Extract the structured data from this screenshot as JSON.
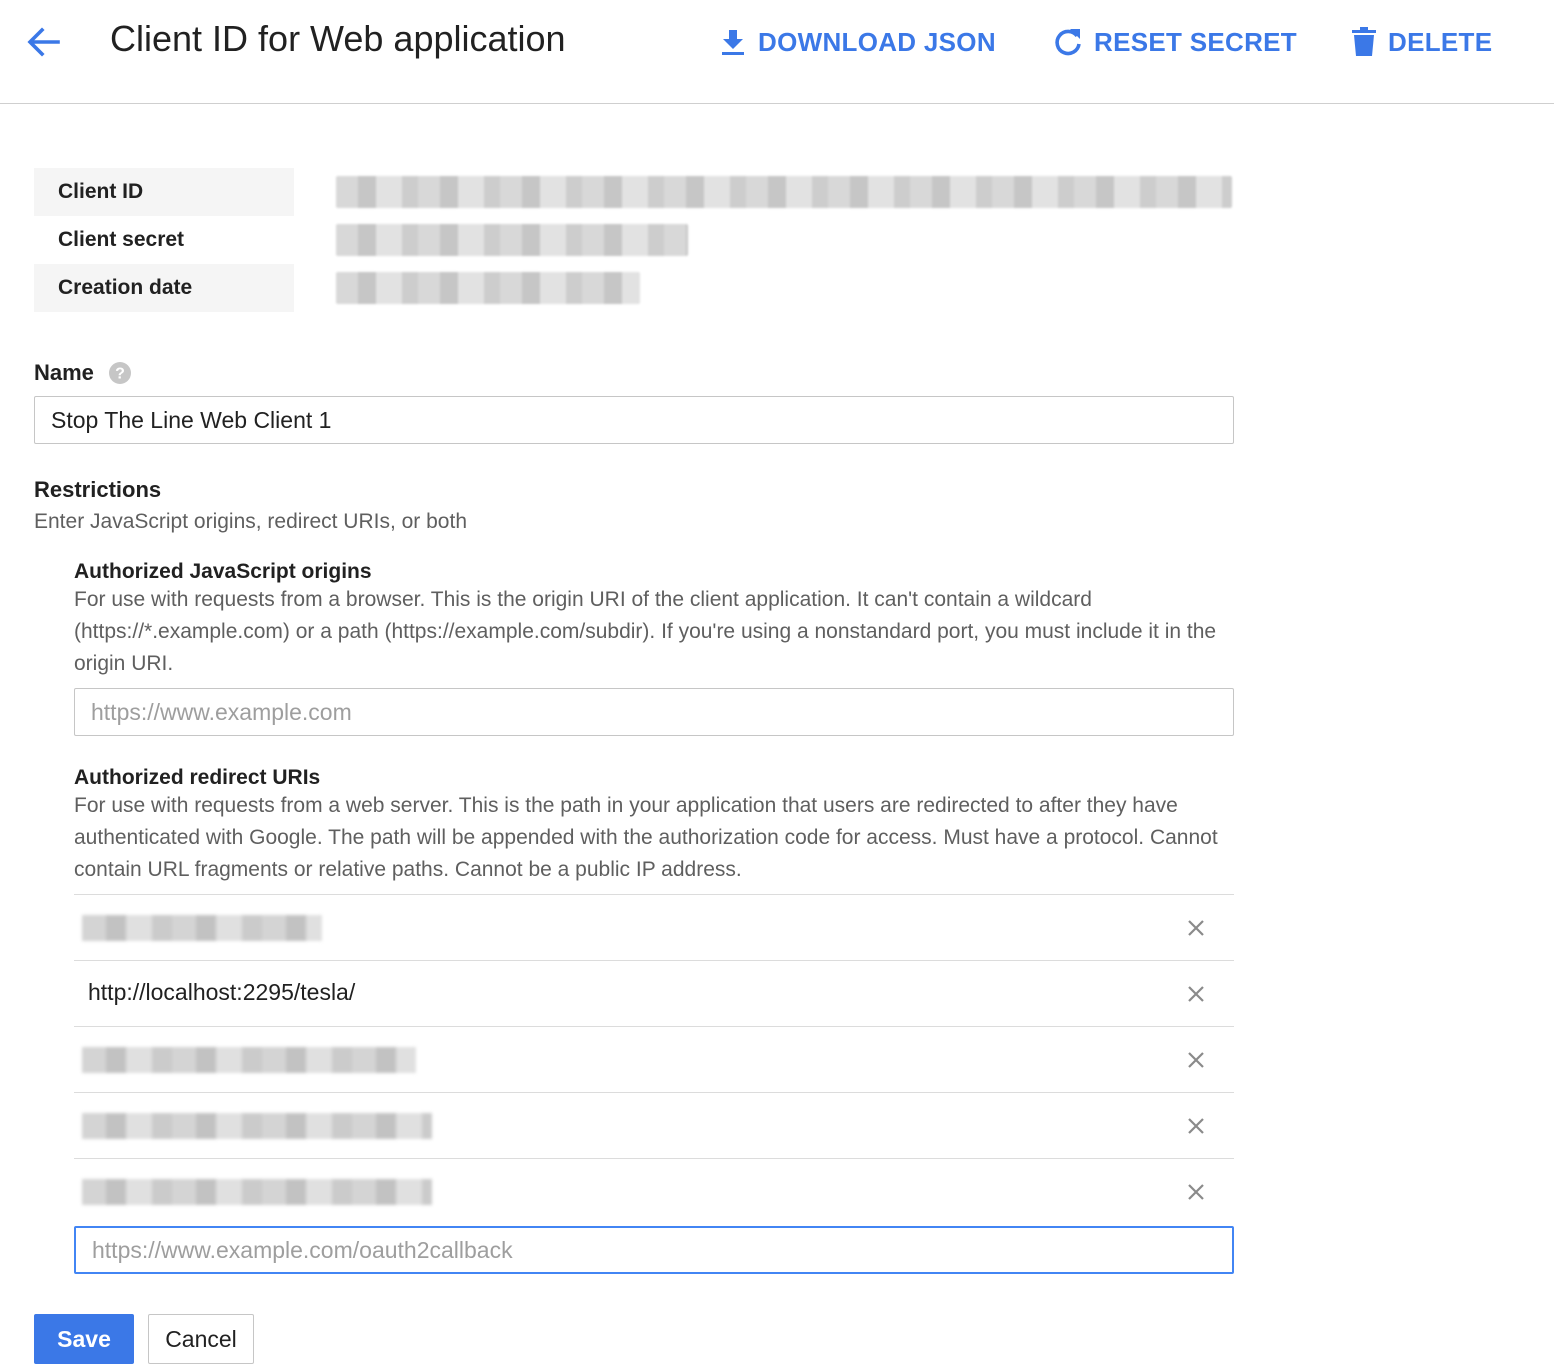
{
  "header": {
    "title": "Client ID for Web application",
    "actions": {
      "download": "DOWNLOAD JSON",
      "reset": "RESET SECRET",
      "delete": "DELETE"
    }
  },
  "credentials": {
    "client_id_label": "Client ID",
    "client_secret_label": "Client secret",
    "creation_date_label": "Creation date"
  },
  "name": {
    "label": "Name",
    "value": "Stop The Line Web Client 1"
  },
  "restrictions": {
    "title": "Restrictions",
    "subtitle": "Enter JavaScript origins, redirect URIs, or both",
    "origins": {
      "title": "Authorized JavaScript origins",
      "description": "For use with requests from a browser. This is the origin URI of the client application. It can't contain a wildcard (https://*.example.com) or a path (https://example.com/subdir). If you're using a nonstandard port, you must include it in the origin URI.",
      "placeholder": "https://www.example.com"
    },
    "redirects": {
      "title": "Authorized redirect URIs",
      "description": "For use with requests from a web server. This is the path in your application that users are redirected to after they have authenticated with Google. The path will be appended with the authorization code for access. Must have a protocol. Cannot contain URL fragments or relative paths. Cannot be a public IP address.",
      "uris": [
        "",
        "http://localhost:2295/tesla/",
        "",
        "",
        ""
      ],
      "placeholder": "https://www.example.com/oauth2callback"
    }
  },
  "buttons": {
    "save": "Save",
    "cancel": "Cancel"
  },
  "icons": {
    "back": "arrow-back-icon",
    "download": "download-icon",
    "reset": "refresh-icon",
    "delete": "trash-icon",
    "help": "help-icon",
    "remove": "close-icon"
  },
  "colors": {
    "accent": "#3b78e7",
    "focus": "#4285f4"
  }
}
